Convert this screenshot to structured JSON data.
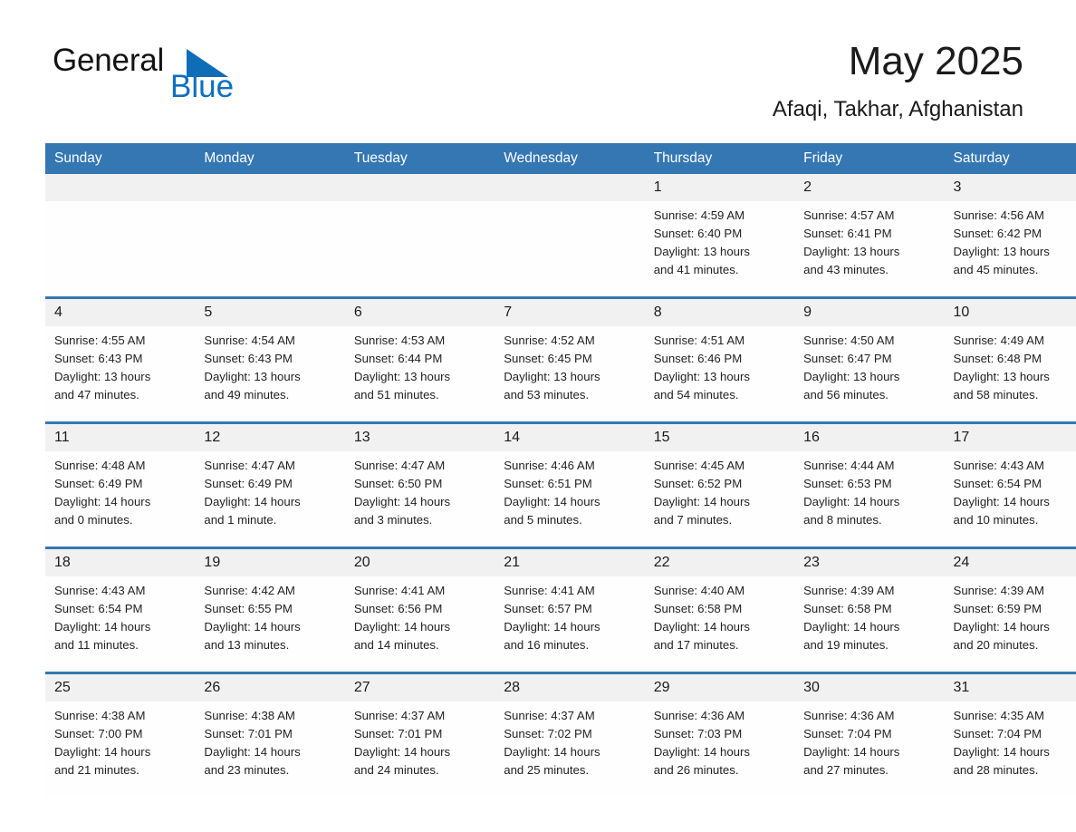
{
  "brand": {
    "name_part1": "General",
    "name_part2": "Blue",
    "triangle_color": "#0f6db8",
    "text_color": "#131313",
    "blue_text_color": "#0d6fc0"
  },
  "header": {
    "title": "May 2025",
    "subtitle": "Afaqi, Takhar, Afghanistan",
    "accent_color": "#3477b3",
    "daynum_band_color": "#f1f1f1"
  },
  "weekday_headers": [
    "Sunday",
    "Monday",
    "Tuesday",
    "Wednesday",
    "Thursday",
    "Friday",
    "Saturday"
  ],
  "weeks": [
    [
      {
        "day": "",
        "lines": []
      },
      {
        "day": "",
        "lines": []
      },
      {
        "day": "",
        "lines": []
      },
      {
        "day": "",
        "lines": []
      },
      {
        "day": "1",
        "lines": [
          "Sunrise: 4:59 AM",
          "Sunset: 6:40 PM",
          "Daylight: 13 hours",
          "and 41 minutes."
        ]
      },
      {
        "day": "2",
        "lines": [
          "Sunrise: 4:57 AM",
          "Sunset: 6:41 PM",
          "Daylight: 13 hours",
          "and 43 minutes."
        ]
      },
      {
        "day": "3",
        "lines": [
          "Sunrise: 4:56 AM",
          "Sunset: 6:42 PM",
          "Daylight: 13 hours",
          "and 45 minutes."
        ]
      }
    ],
    [
      {
        "day": "4",
        "lines": [
          "Sunrise: 4:55 AM",
          "Sunset: 6:43 PM",
          "Daylight: 13 hours",
          "and 47 minutes."
        ]
      },
      {
        "day": "5",
        "lines": [
          "Sunrise: 4:54 AM",
          "Sunset: 6:43 PM",
          "Daylight: 13 hours",
          "and 49 minutes."
        ]
      },
      {
        "day": "6",
        "lines": [
          "Sunrise: 4:53 AM",
          "Sunset: 6:44 PM",
          "Daylight: 13 hours",
          "and 51 minutes."
        ]
      },
      {
        "day": "7",
        "lines": [
          "Sunrise: 4:52 AM",
          "Sunset: 6:45 PM",
          "Daylight: 13 hours",
          "and 53 minutes."
        ]
      },
      {
        "day": "8",
        "lines": [
          "Sunrise: 4:51 AM",
          "Sunset: 6:46 PM",
          "Daylight: 13 hours",
          "and 54 minutes."
        ]
      },
      {
        "day": "9",
        "lines": [
          "Sunrise: 4:50 AM",
          "Sunset: 6:47 PM",
          "Daylight: 13 hours",
          "and 56 minutes."
        ]
      },
      {
        "day": "10",
        "lines": [
          "Sunrise: 4:49 AM",
          "Sunset: 6:48 PM",
          "Daylight: 13 hours",
          "and 58 minutes."
        ]
      }
    ],
    [
      {
        "day": "11",
        "lines": [
          "Sunrise: 4:48 AM",
          "Sunset: 6:49 PM",
          "Daylight: 14 hours",
          "and 0 minutes."
        ]
      },
      {
        "day": "12",
        "lines": [
          "Sunrise: 4:47 AM",
          "Sunset: 6:49 PM",
          "Daylight: 14 hours",
          "and 1 minute."
        ]
      },
      {
        "day": "13",
        "lines": [
          "Sunrise: 4:47 AM",
          "Sunset: 6:50 PM",
          "Daylight: 14 hours",
          "and 3 minutes."
        ]
      },
      {
        "day": "14",
        "lines": [
          "Sunrise: 4:46 AM",
          "Sunset: 6:51 PM",
          "Daylight: 14 hours",
          "and 5 minutes."
        ]
      },
      {
        "day": "15",
        "lines": [
          "Sunrise: 4:45 AM",
          "Sunset: 6:52 PM",
          "Daylight: 14 hours",
          "and 7 minutes."
        ]
      },
      {
        "day": "16",
        "lines": [
          "Sunrise: 4:44 AM",
          "Sunset: 6:53 PM",
          "Daylight: 14 hours",
          "and 8 minutes."
        ]
      },
      {
        "day": "17",
        "lines": [
          "Sunrise: 4:43 AM",
          "Sunset: 6:54 PM",
          "Daylight: 14 hours",
          "and 10 minutes."
        ]
      }
    ],
    [
      {
        "day": "18",
        "lines": [
          "Sunrise: 4:43 AM",
          "Sunset: 6:54 PM",
          "Daylight: 14 hours",
          "and 11 minutes."
        ]
      },
      {
        "day": "19",
        "lines": [
          "Sunrise: 4:42 AM",
          "Sunset: 6:55 PM",
          "Daylight: 14 hours",
          "and 13 minutes."
        ]
      },
      {
        "day": "20",
        "lines": [
          "Sunrise: 4:41 AM",
          "Sunset: 6:56 PM",
          "Daylight: 14 hours",
          "and 14 minutes."
        ]
      },
      {
        "day": "21",
        "lines": [
          "Sunrise: 4:41 AM",
          "Sunset: 6:57 PM",
          "Daylight: 14 hours",
          "and 16 minutes."
        ]
      },
      {
        "day": "22",
        "lines": [
          "Sunrise: 4:40 AM",
          "Sunset: 6:58 PM",
          "Daylight: 14 hours",
          "and 17 minutes."
        ]
      },
      {
        "day": "23",
        "lines": [
          "Sunrise: 4:39 AM",
          "Sunset: 6:58 PM",
          "Daylight: 14 hours",
          "and 19 minutes."
        ]
      },
      {
        "day": "24",
        "lines": [
          "Sunrise: 4:39 AM",
          "Sunset: 6:59 PM",
          "Daylight: 14 hours",
          "and 20 minutes."
        ]
      }
    ],
    [
      {
        "day": "25",
        "lines": [
          "Sunrise: 4:38 AM",
          "Sunset: 7:00 PM",
          "Daylight: 14 hours",
          "and 21 minutes."
        ]
      },
      {
        "day": "26",
        "lines": [
          "Sunrise: 4:38 AM",
          "Sunset: 7:01 PM",
          "Daylight: 14 hours",
          "and 23 minutes."
        ]
      },
      {
        "day": "27",
        "lines": [
          "Sunrise: 4:37 AM",
          "Sunset: 7:01 PM",
          "Daylight: 14 hours",
          "and 24 minutes."
        ]
      },
      {
        "day": "28",
        "lines": [
          "Sunrise: 4:37 AM",
          "Sunset: 7:02 PM",
          "Daylight: 14 hours",
          "and 25 minutes."
        ]
      },
      {
        "day": "29",
        "lines": [
          "Sunrise: 4:36 AM",
          "Sunset: 7:03 PM",
          "Daylight: 14 hours",
          "and 26 minutes."
        ]
      },
      {
        "day": "30",
        "lines": [
          "Sunrise: 4:36 AM",
          "Sunset: 7:04 PM",
          "Daylight: 14 hours",
          "and 27 minutes."
        ]
      },
      {
        "day": "31",
        "lines": [
          "Sunrise: 4:35 AM",
          "Sunset: 7:04 PM",
          "Daylight: 14 hours",
          "and 28 minutes."
        ]
      }
    ]
  ]
}
